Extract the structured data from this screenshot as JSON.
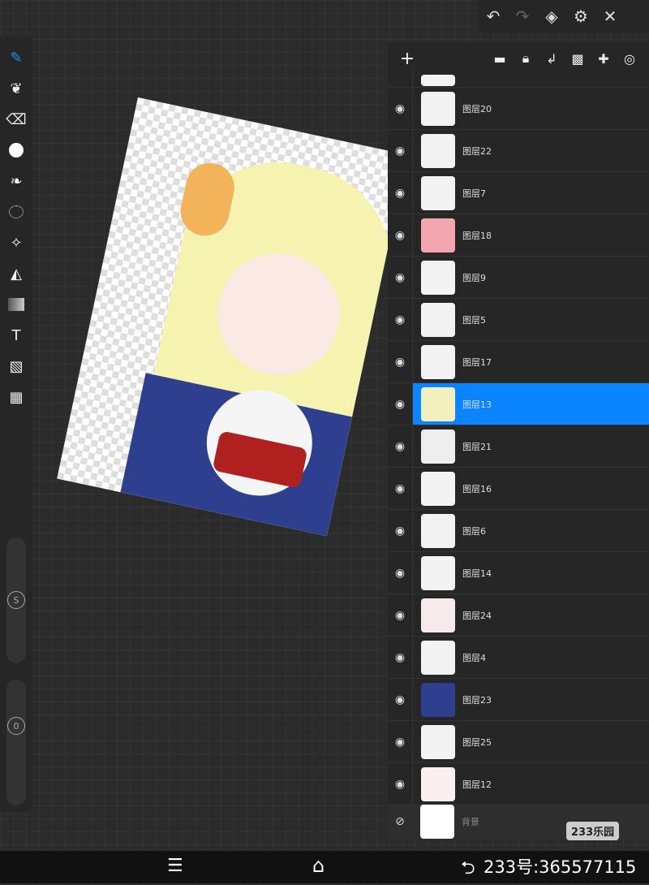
{
  "topbar": {
    "icons": [
      "undo-icon",
      "redo-icon",
      "layers-icon",
      "gear-icon",
      "close-icon"
    ]
  },
  "toolbar": {
    "tools": [
      "brush",
      "smudge",
      "eraser",
      "color",
      "leaf-brush",
      "lasso",
      "magic-wand",
      "fill",
      "gradient",
      "text",
      "image-import",
      "grid"
    ],
    "size_label": "S",
    "opacity_label": "0"
  },
  "layers_panel": {
    "header_icons": [
      "add",
      "folder",
      "lock",
      "merge-down",
      "transparency",
      "pin",
      "target"
    ],
    "layers": [
      {
        "name": "图层20"
      },
      {
        "name": "图层22"
      },
      {
        "name": "图层7"
      },
      {
        "name": "图层18"
      },
      {
        "name": "图层9"
      },
      {
        "name": "图层5"
      },
      {
        "name": "图层17"
      },
      {
        "name": "图层13",
        "selected": true
      },
      {
        "name": "图层21"
      },
      {
        "name": "图层16"
      },
      {
        "name": "图层6"
      },
      {
        "name": "图层14"
      },
      {
        "name": "图层24"
      },
      {
        "name": "图层4"
      },
      {
        "name": "图层23"
      },
      {
        "name": "图层25"
      },
      {
        "name": "图层12"
      }
    ],
    "background": "背景"
  },
  "watermark": {
    "logo": "233乐园",
    "id_text": "233号:365577115"
  },
  "colors": {
    "accent": "#0a84ff"
  }
}
